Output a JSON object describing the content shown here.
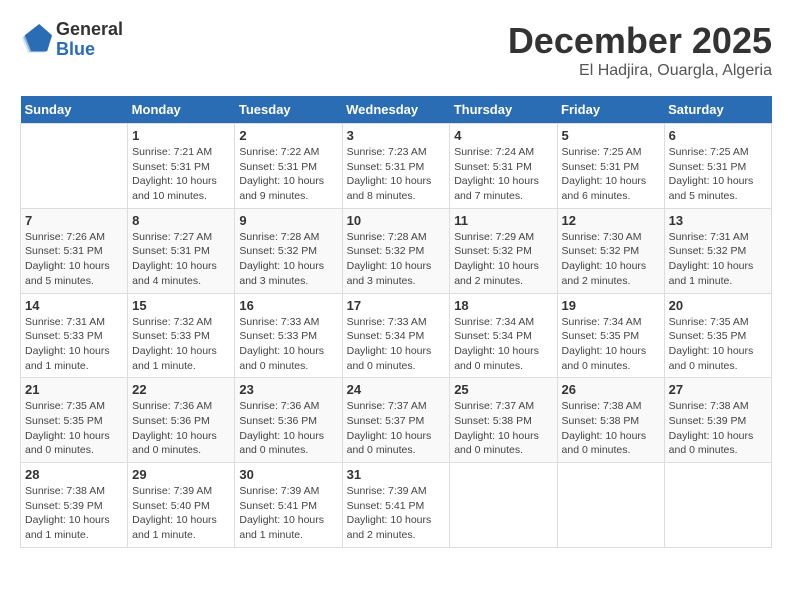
{
  "logo": {
    "general": "General",
    "blue": "Blue"
  },
  "title": "December 2025",
  "location": "El Hadjira, Ouargla, Algeria",
  "days_of_week": [
    "Sunday",
    "Monday",
    "Tuesday",
    "Wednesday",
    "Thursday",
    "Friday",
    "Saturday"
  ],
  "weeks": [
    [
      {
        "day": "",
        "info": ""
      },
      {
        "day": "1",
        "info": "Sunrise: 7:21 AM\nSunset: 5:31 PM\nDaylight: 10 hours and 10 minutes."
      },
      {
        "day": "2",
        "info": "Sunrise: 7:22 AM\nSunset: 5:31 PM\nDaylight: 10 hours and 9 minutes."
      },
      {
        "day": "3",
        "info": "Sunrise: 7:23 AM\nSunset: 5:31 PM\nDaylight: 10 hours and 8 minutes."
      },
      {
        "day": "4",
        "info": "Sunrise: 7:24 AM\nSunset: 5:31 PM\nDaylight: 10 hours and 7 minutes."
      },
      {
        "day": "5",
        "info": "Sunrise: 7:25 AM\nSunset: 5:31 PM\nDaylight: 10 hours and 6 minutes."
      },
      {
        "day": "6",
        "info": "Sunrise: 7:25 AM\nSunset: 5:31 PM\nDaylight: 10 hours and 5 minutes."
      }
    ],
    [
      {
        "day": "7",
        "info": "Sunrise: 7:26 AM\nSunset: 5:31 PM\nDaylight: 10 hours and 5 minutes."
      },
      {
        "day": "8",
        "info": "Sunrise: 7:27 AM\nSunset: 5:31 PM\nDaylight: 10 hours and 4 minutes."
      },
      {
        "day": "9",
        "info": "Sunrise: 7:28 AM\nSunset: 5:32 PM\nDaylight: 10 hours and 3 minutes."
      },
      {
        "day": "10",
        "info": "Sunrise: 7:28 AM\nSunset: 5:32 PM\nDaylight: 10 hours and 3 minutes."
      },
      {
        "day": "11",
        "info": "Sunrise: 7:29 AM\nSunset: 5:32 PM\nDaylight: 10 hours and 2 minutes."
      },
      {
        "day": "12",
        "info": "Sunrise: 7:30 AM\nSunset: 5:32 PM\nDaylight: 10 hours and 2 minutes."
      },
      {
        "day": "13",
        "info": "Sunrise: 7:31 AM\nSunset: 5:32 PM\nDaylight: 10 hours and 1 minute."
      }
    ],
    [
      {
        "day": "14",
        "info": "Sunrise: 7:31 AM\nSunset: 5:33 PM\nDaylight: 10 hours and 1 minute."
      },
      {
        "day": "15",
        "info": "Sunrise: 7:32 AM\nSunset: 5:33 PM\nDaylight: 10 hours and 1 minute."
      },
      {
        "day": "16",
        "info": "Sunrise: 7:33 AM\nSunset: 5:33 PM\nDaylight: 10 hours and 0 minutes."
      },
      {
        "day": "17",
        "info": "Sunrise: 7:33 AM\nSunset: 5:34 PM\nDaylight: 10 hours and 0 minutes."
      },
      {
        "day": "18",
        "info": "Sunrise: 7:34 AM\nSunset: 5:34 PM\nDaylight: 10 hours and 0 minutes."
      },
      {
        "day": "19",
        "info": "Sunrise: 7:34 AM\nSunset: 5:35 PM\nDaylight: 10 hours and 0 minutes."
      },
      {
        "day": "20",
        "info": "Sunrise: 7:35 AM\nSunset: 5:35 PM\nDaylight: 10 hours and 0 minutes."
      }
    ],
    [
      {
        "day": "21",
        "info": "Sunrise: 7:35 AM\nSunset: 5:35 PM\nDaylight: 10 hours and 0 minutes."
      },
      {
        "day": "22",
        "info": "Sunrise: 7:36 AM\nSunset: 5:36 PM\nDaylight: 10 hours and 0 minutes."
      },
      {
        "day": "23",
        "info": "Sunrise: 7:36 AM\nSunset: 5:36 PM\nDaylight: 10 hours and 0 minutes."
      },
      {
        "day": "24",
        "info": "Sunrise: 7:37 AM\nSunset: 5:37 PM\nDaylight: 10 hours and 0 minutes."
      },
      {
        "day": "25",
        "info": "Sunrise: 7:37 AM\nSunset: 5:38 PM\nDaylight: 10 hours and 0 minutes."
      },
      {
        "day": "26",
        "info": "Sunrise: 7:38 AM\nSunset: 5:38 PM\nDaylight: 10 hours and 0 minutes."
      },
      {
        "day": "27",
        "info": "Sunrise: 7:38 AM\nSunset: 5:39 PM\nDaylight: 10 hours and 0 minutes."
      }
    ],
    [
      {
        "day": "28",
        "info": "Sunrise: 7:38 AM\nSunset: 5:39 PM\nDaylight: 10 hours and 1 minute."
      },
      {
        "day": "29",
        "info": "Sunrise: 7:39 AM\nSunset: 5:40 PM\nDaylight: 10 hours and 1 minute."
      },
      {
        "day": "30",
        "info": "Sunrise: 7:39 AM\nSunset: 5:41 PM\nDaylight: 10 hours and 1 minute."
      },
      {
        "day": "31",
        "info": "Sunrise: 7:39 AM\nSunset: 5:41 PM\nDaylight: 10 hours and 2 minutes."
      },
      {
        "day": "",
        "info": ""
      },
      {
        "day": "",
        "info": ""
      },
      {
        "day": "",
        "info": ""
      }
    ]
  ]
}
